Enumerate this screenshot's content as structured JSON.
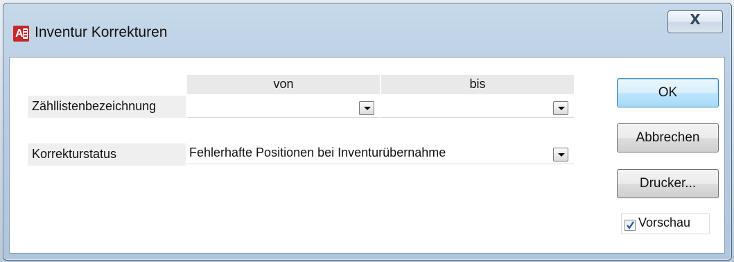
{
  "window": {
    "title": "Inventur Korrekturen",
    "icon": "access-app-icon",
    "icon_letter": "A",
    "close_glyph": "X"
  },
  "form": {
    "col_from": "von",
    "col_to": "bis",
    "row1_label": "Zähllistenbezeichnung",
    "row1_from_value": "",
    "row1_to_value": "",
    "row2_label": "Korrekturstatus",
    "row2_value": "Fehlerhafte Positionen bei Inventurübernahme"
  },
  "buttons": {
    "ok": "OK",
    "cancel": "Abbrechen",
    "printer": "Drucker..."
  },
  "preview": {
    "label": "Vorschau",
    "checked": true
  },
  "colors": {
    "accent": "#3c7fb1",
    "icon_red": "#c7262b",
    "check_blue": "#2a5fa8"
  }
}
